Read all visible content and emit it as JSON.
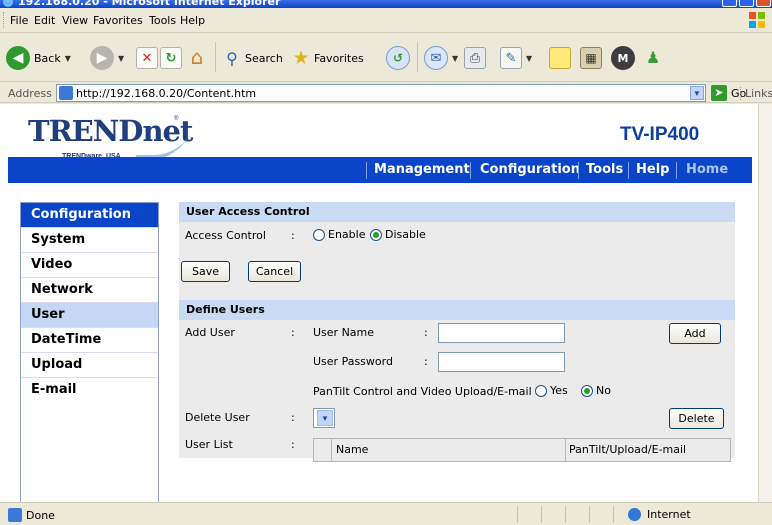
{
  "window": {
    "title": "192.168.0.20 - Microsoft Internet Explorer"
  },
  "menu": [
    "File",
    "Edit",
    "View",
    "Favorites",
    "Tools",
    "Help"
  ],
  "toolbar": {
    "back": "Back",
    "search": "Search",
    "favorites": "Favorites",
    "icons": [
      "back-icon",
      "forward-icon",
      "stop-icon",
      "refresh-icon",
      "home-icon",
      "search-icon",
      "favorites-icon",
      "history-icon",
      "mail-icon",
      "print-icon",
      "edit-icon",
      "discuss-icon",
      "folder-icon",
      "messenger-icon",
      "msn-icon"
    ]
  },
  "address": {
    "label": "Address",
    "url": "http://192.168.0.20/Content.htm",
    "go": "Go",
    "links": "Links"
  },
  "header": {
    "brand": "TRENDnet",
    "tagline": "TRENDware, USA",
    "model": "TV-IP400"
  },
  "nav": [
    "Management",
    "Configuration",
    "Tools",
    "Help",
    "Home"
  ],
  "sidebar": {
    "heading": "Configuration",
    "items": [
      "System",
      "Video",
      "Network",
      "User",
      "DateTime",
      "Upload",
      "E-mail"
    ],
    "active": "User"
  },
  "access": {
    "section": "User Access Control",
    "label": "Access Control",
    "colon": ":",
    "enable": "Enable",
    "disable": "Disable",
    "selected": "Disable",
    "save": "Save",
    "cancel": "Cancel"
  },
  "define": {
    "section": "Define Users",
    "add_user": "Add User",
    "user_name": "User Name",
    "user_password": "User Password",
    "pantilt_label": "PanTilt Control and Video Upload/E-mail :",
    "yes": "Yes",
    "no": "No",
    "pantilt_selected": "No",
    "add_button": "Add",
    "delete_user": "Delete User",
    "delete_button": "Delete",
    "user_list": "User List",
    "columns": [
      "Name",
      "PanTilt/Upload/E-mail"
    ]
  },
  "status": {
    "text": "Done",
    "zone": "Internet"
  }
}
